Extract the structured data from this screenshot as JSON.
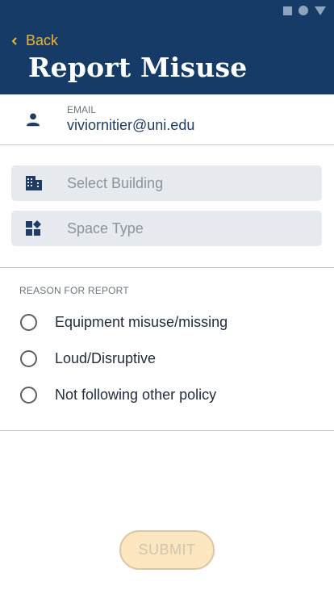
{
  "header": {
    "back_label": "Back",
    "title": "Report Misuse",
    "background": "#163b66",
    "accent": "#f2b632"
  },
  "status_bar": {
    "icons": [
      "square-icon",
      "circle-icon",
      "triangle-icon"
    ]
  },
  "email": {
    "label": "EMAIL",
    "value": "viviornitier@uni.edu",
    "icon": "person-icon"
  },
  "fields": {
    "building": {
      "placeholder": "Select Building",
      "icon": "building-icon"
    },
    "space_type": {
      "placeholder": "Space Type",
      "icon": "dashboard-icon"
    }
  },
  "reason": {
    "label": "REASON FOR REPORT",
    "options": [
      {
        "label": "Equipment misuse/missing",
        "selected": false
      },
      {
        "label": "Loud/Disruptive",
        "selected": false
      },
      {
        "label": "Not following other policy",
        "selected": false
      }
    ]
  },
  "submit": {
    "label": "SUBMIT",
    "disabled": true
  }
}
